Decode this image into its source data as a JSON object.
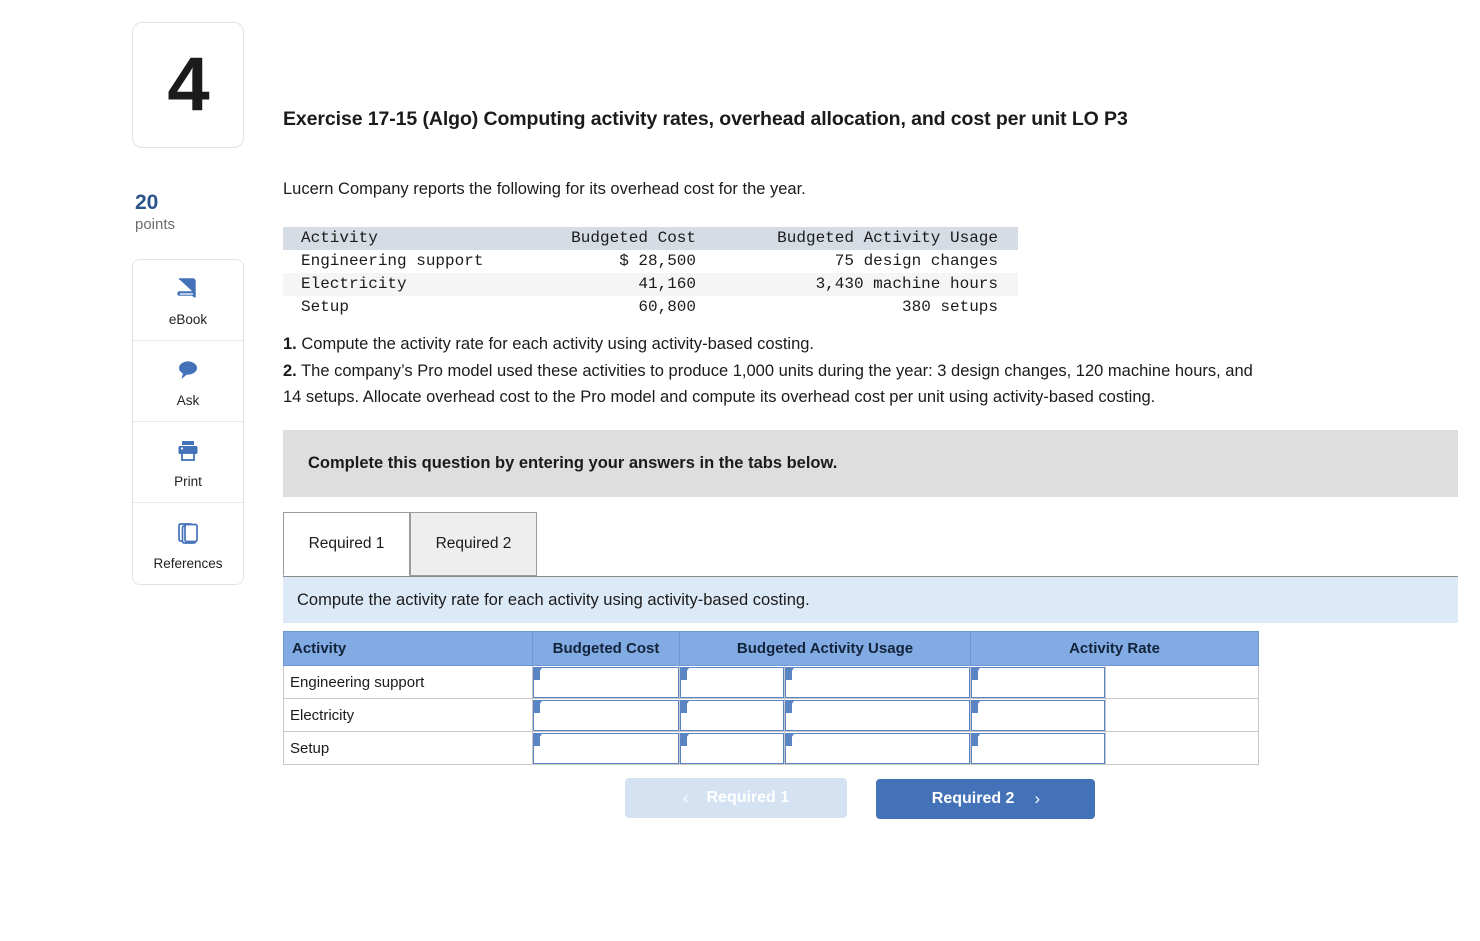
{
  "question": {
    "number": "4",
    "points_value": "20",
    "points_label": "points",
    "title": "Exercise 17-15 (Algo) Computing activity rates, overhead allocation, and cost per unit LO P3",
    "intro": "Lucern Company reports the following for its overhead cost for the year."
  },
  "tools": [
    {
      "label": "eBook",
      "icon": "book-icon"
    },
    {
      "label": "Ask",
      "icon": "chat-bubble-icon"
    },
    {
      "label": "Print",
      "icon": "printer-icon"
    },
    {
      "label": "References",
      "icon": "copy-pages-icon"
    }
  ],
  "given_table": {
    "headers": [
      "Activity",
      "Budgeted Cost",
      "Budgeted Activity Usage"
    ],
    "rows": [
      {
        "activity": "Engineering support",
        "cost": "$ 28,500",
        "usage": "75 design changes"
      },
      {
        "activity": "Electricity",
        "cost": "41,160",
        "usage": "3,430 machine hours"
      },
      {
        "activity": "Setup",
        "cost": "60,800",
        "usage": "380 setups"
      }
    ]
  },
  "requirements": {
    "r1_num": "1.",
    "r1_text": "Compute the activity rate for each activity using activity-based costing.",
    "r2_num": "2.",
    "r2_line1": "The company’s Pro model used these activities to produce 1,000 units during the year: 3 design changes, 120 machine hours, and",
    "r2_line2": "14 setups. Allocate overhead cost to the Pro model and compute its overhead cost per unit using activity-based costing."
  },
  "banner": {
    "text": "Complete this question by entering your answers in the tabs below."
  },
  "tabs": [
    {
      "label": "Required 1",
      "active": true
    },
    {
      "label": "Required 2",
      "active": false
    }
  ],
  "instruction": {
    "text": "Compute the activity rate for each activity using activity-based costing."
  },
  "answer_table": {
    "headers": [
      "Activity",
      "Budgeted Cost",
      "Budgeted Activity Usage",
      "Activity Rate"
    ],
    "rows": [
      {
        "activity": "Engineering support",
        "budgeted_cost": "",
        "usage_num": "",
        "usage_unit": "",
        "rate_num": "",
        "rate_unit": ""
      },
      {
        "activity": "Electricity",
        "budgeted_cost": "",
        "usage_num": "",
        "usage_unit": "",
        "rate_num": "",
        "rate_unit": ""
      },
      {
        "activity": "Setup",
        "budgeted_cost": "",
        "usage_num": "",
        "usage_unit": "",
        "rate_num": "",
        "rate_unit": ""
      }
    ]
  },
  "nav": {
    "prev_label": "Required 1",
    "prev_chevron": "‹",
    "next_label": "Required 2",
    "next_chevron": "›"
  },
  "colors": {
    "accent_blue": "#4472b8",
    "header_blue": "#82aae3",
    "band_blue": "#dce9f7",
    "banner_grey": "#dedede",
    "points_blue": "#2c5488"
  }
}
